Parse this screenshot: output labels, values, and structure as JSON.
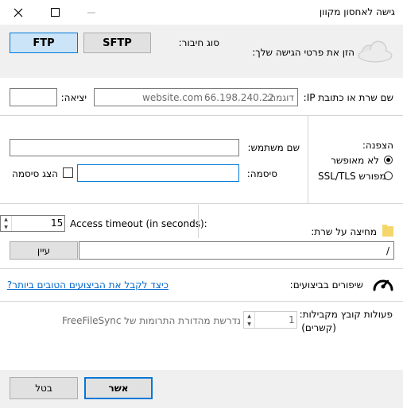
{
  "window": {
    "title": "גישה לאחסון מקוון"
  },
  "connection": {
    "type_label": "סוג חיבור:",
    "sftp_label": "SFTP",
    "ftp_label": "FTP",
    "instruction": "הזן את פרטי הגישה שלך:"
  },
  "server": {
    "label": "שם שרת או כתובת IP:",
    "example_label": "דוגמה:",
    "example_ip": "66.198.240.22",
    "example_host": "website.com",
    "port_label": "יציאה:",
    "port_value": ""
  },
  "auth": {
    "username_label": "שם משתמש:",
    "username_value": "",
    "password_label": "סיסמה:",
    "password_value": "",
    "show_password_label": "הצג סיסמה"
  },
  "encryption": {
    "label": "הצפנה:",
    "options": [
      "לא מאופשר",
      "SSL/TLS מפורש"
    ],
    "selected": "לא מאופשר"
  },
  "timeout": {
    "label": "Access timeout (in seconds):",
    "value": "15"
  },
  "folder": {
    "label": "מחיצה על שרת:",
    "path": "/",
    "browse_label": "עיין"
  },
  "performance": {
    "label": "שיפורים בביצועים:",
    "link": "כיצד לקבל את הביצועים הטובים ביותר?"
  },
  "parallel": {
    "label_line1": "פעולות קובץ מקבילות:",
    "label_line2": "(קשרים)",
    "value": "1",
    "note_inline": "נדרשת מהדורת התרומות של",
    "note_app": "FreeFileSync"
  },
  "footer": {
    "ok_label": "אשר",
    "cancel_label": "בטל"
  }
}
